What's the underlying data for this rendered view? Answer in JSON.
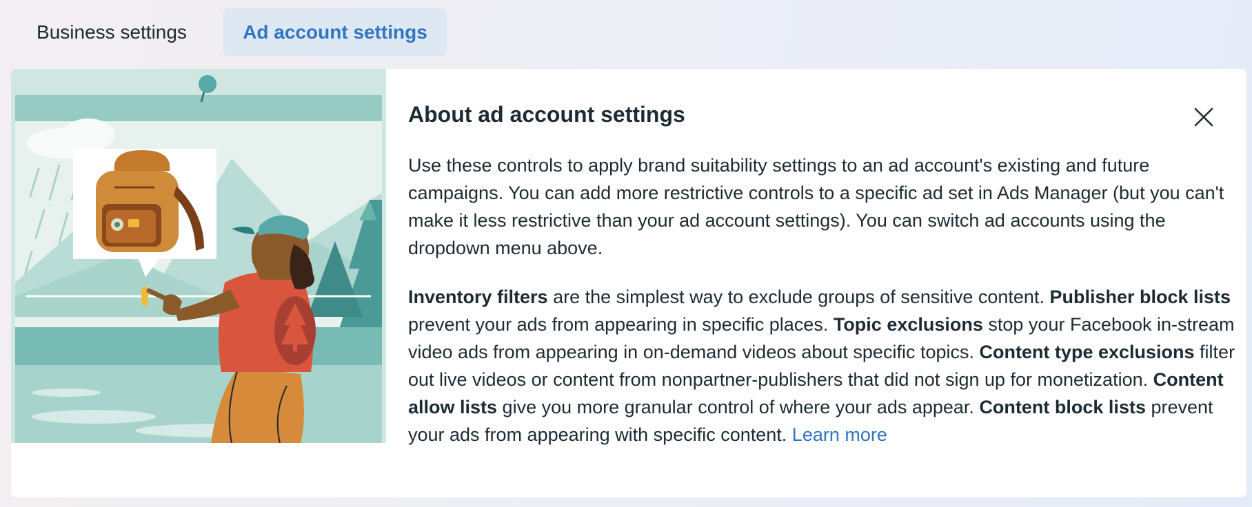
{
  "tabs": [
    {
      "label": "Business settings",
      "active": false
    },
    {
      "label": "Ad account settings",
      "active": true
    }
  ],
  "panel": {
    "title": "About ad account settings",
    "close_icon": "close-icon",
    "illustration": "person-pointing-at-slider-with-backpack-illustration",
    "intro": "Use these controls to apply brand suitability settings to an ad account's existing and future campaigns. You can add more restrictive controls to a specific ad set in Ads Manager (but you can't make it less restrictive than your ad account settings). You can switch ad accounts using the dropdown menu above.",
    "details": {
      "t1": "Inventory filters",
      "d1": " are the simplest way to exclude groups of sensitive content. ",
      "t2": "Publisher block lists",
      "d2": " prevent your ads from appearing in specific places. ",
      "t3": "Topic exclusions",
      "d3": " stop your Facebook in-stream video ads from appearing in on-demand videos about specific topics. ",
      "t4": "Content type exclusions",
      "d4": " filter out live videos or content from nonpartner-publishers that did not sign up for monetization. ",
      "t5": "Content allow lists",
      "d5": " give you more granular control of where your ads appear. ",
      "t6": "Content block lists",
      "d6": " prevent your ads from appearing with specific content. "
    },
    "learn_more": "Learn more"
  },
  "colors": {
    "accent": "#2f75c0",
    "active_tab_bg": "#dde8f3",
    "text": "#1c2b33"
  }
}
